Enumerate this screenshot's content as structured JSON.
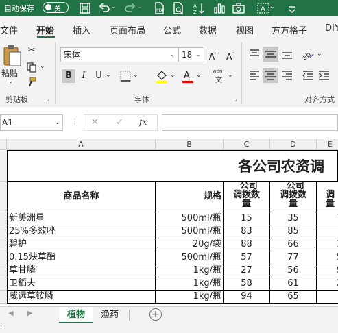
{
  "titlebar": {
    "autosave_label": "自动保存",
    "toggle_state": "关"
  },
  "tabs": [
    "文件",
    "开始",
    "插入",
    "页面布局",
    "公式",
    "数据",
    "视图",
    "方方格子",
    "DIY"
  ],
  "ribbon": {
    "paste_label": "粘贴",
    "clipboard_label": "剪贴板",
    "font_name": "宋体",
    "font_size": "18",
    "font_group_label": "字体",
    "align_group_label": "对齐方式",
    "bold": "B",
    "italic": "I",
    "underline": "U",
    "phonetic": "wén"
  },
  "formula_bar": {
    "name_box": "A1",
    "fx": "fx"
  },
  "grid": {
    "columns": [
      "A",
      "B",
      "C",
      "D",
      "E"
    ],
    "title": "各公司农资调",
    "header": {
      "name": "商品名称",
      "spec": "规格",
      "c": "_公司\n调拨数\n量",
      "d": "_公司\n调拨数\n量",
      "e": "_\n调\n量"
    },
    "rows": [
      {
        "name": "新美洲星",
        "spec": "500ml/瓶",
        "c": "15",
        "d": "35",
        "e": "7"
      },
      {
        "name": "25%多效唑",
        "spec": "500ml/瓶",
        "c": "83",
        "d": "85",
        "e": ""
      },
      {
        "name": "碧护",
        "spec": "20g/袋",
        "c": "88",
        "d": "66",
        "e": "1"
      },
      {
        "name": "0.15炔草酯",
        "spec": "500ml/瓶",
        "c": "57",
        "d": "77",
        "e": "5"
      },
      {
        "name": "草甘膦",
        "spec": "1kg/瓶",
        "c": "27",
        "d": "56",
        "e": "9"
      },
      {
        "name": "卫稻夫",
        "spec": "1kg/瓶",
        "c": "58",
        "d": "61",
        "e": "2"
      },
      {
        "name": "威远草铵膦",
        "spec": "1kg/瓶",
        "c": "94",
        "d": "65",
        "e": ""
      }
    ]
  },
  "sheets": [
    "植物",
    "渔药"
  ],
  "colors": {
    "accent": "#217346"
  }
}
